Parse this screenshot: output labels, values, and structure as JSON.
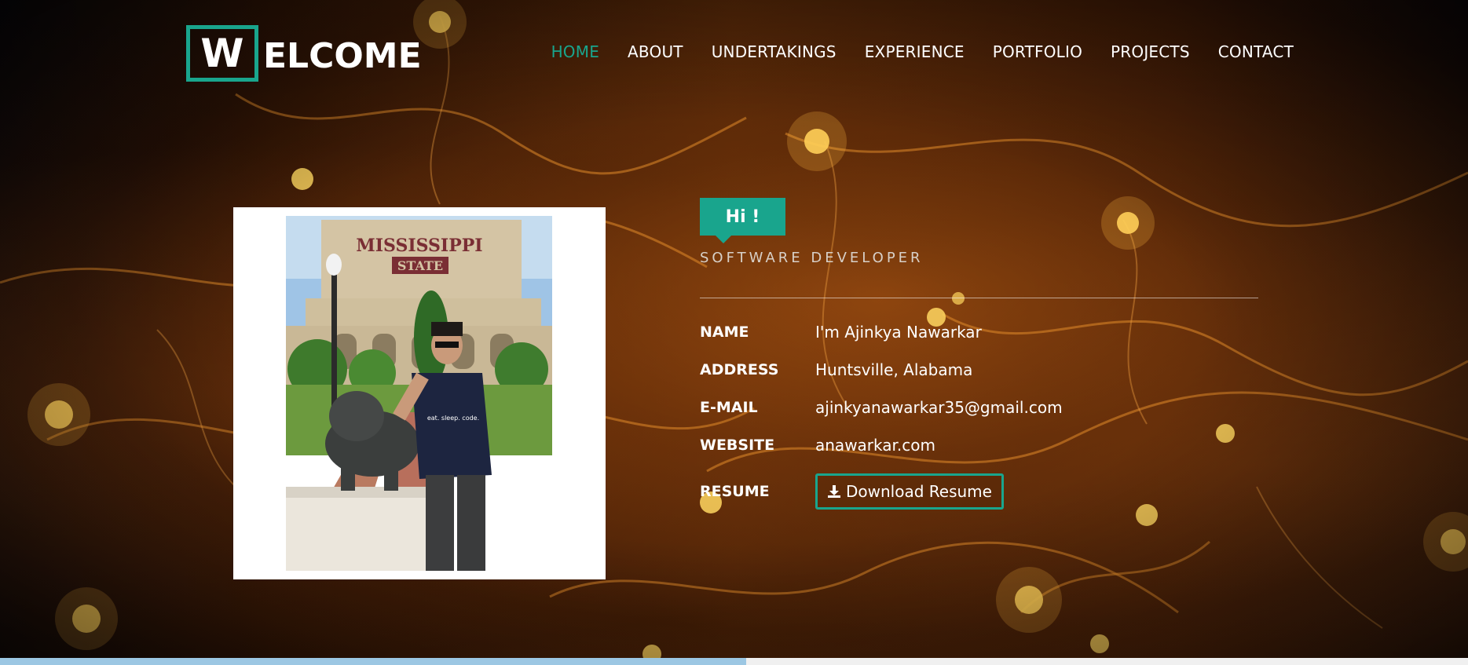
{
  "header": {
    "logo_initial": "W",
    "logo_rest": "ELCOME",
    "nav": [
      {
        "label": "HOME",
        "active": true
      },
      {
        "label": "ABOUT",
        "active": false
      },
      {
        "label": "UNDERTAKINGS",
        "active": false
      },
      {
        "label": "EXPERIENCE",
        "active": false
      },
      {
        "label": "PORTFOLIO",
        "active": false
      },
      {
        "label": "PROJECTS",
        "active": false
      },
      {
        "label": "CONTACT",
        "active": false
      }
    ]
  },
  "profile": {
    "photo_sign_line1": "MISSISSIPPI",
    "photo_sign_line2": "STATE",
    "photo_shirt_text": "eat. sleep. code."
  },
  "intro": {
    "greeting": "Hi !",
    "role": "SOFTWARE DEVELOPER"
  },
  "details": {
    "name_label": "NAME",
    "name_value": "I'm Ajinkya Nawarkar",
    "address_label": "ADDRESS",
    "address_value": "Huntsville, Alabama",
    "email_label": "E-MAIL",
    "email_value": "ajinkyanawarkar35@gmail.com",
    "website_label": "WEBSITE",
    "website_value": "anawarkar.com",
    "resume_label": "RESUME",
    "resume_button": "Download Resume"
  },
  "colors": {
    "accent": "#19a58d",
    "text": "#ffffff"
  },
  "icons": {
    "download": "download-icon"
  }
}
